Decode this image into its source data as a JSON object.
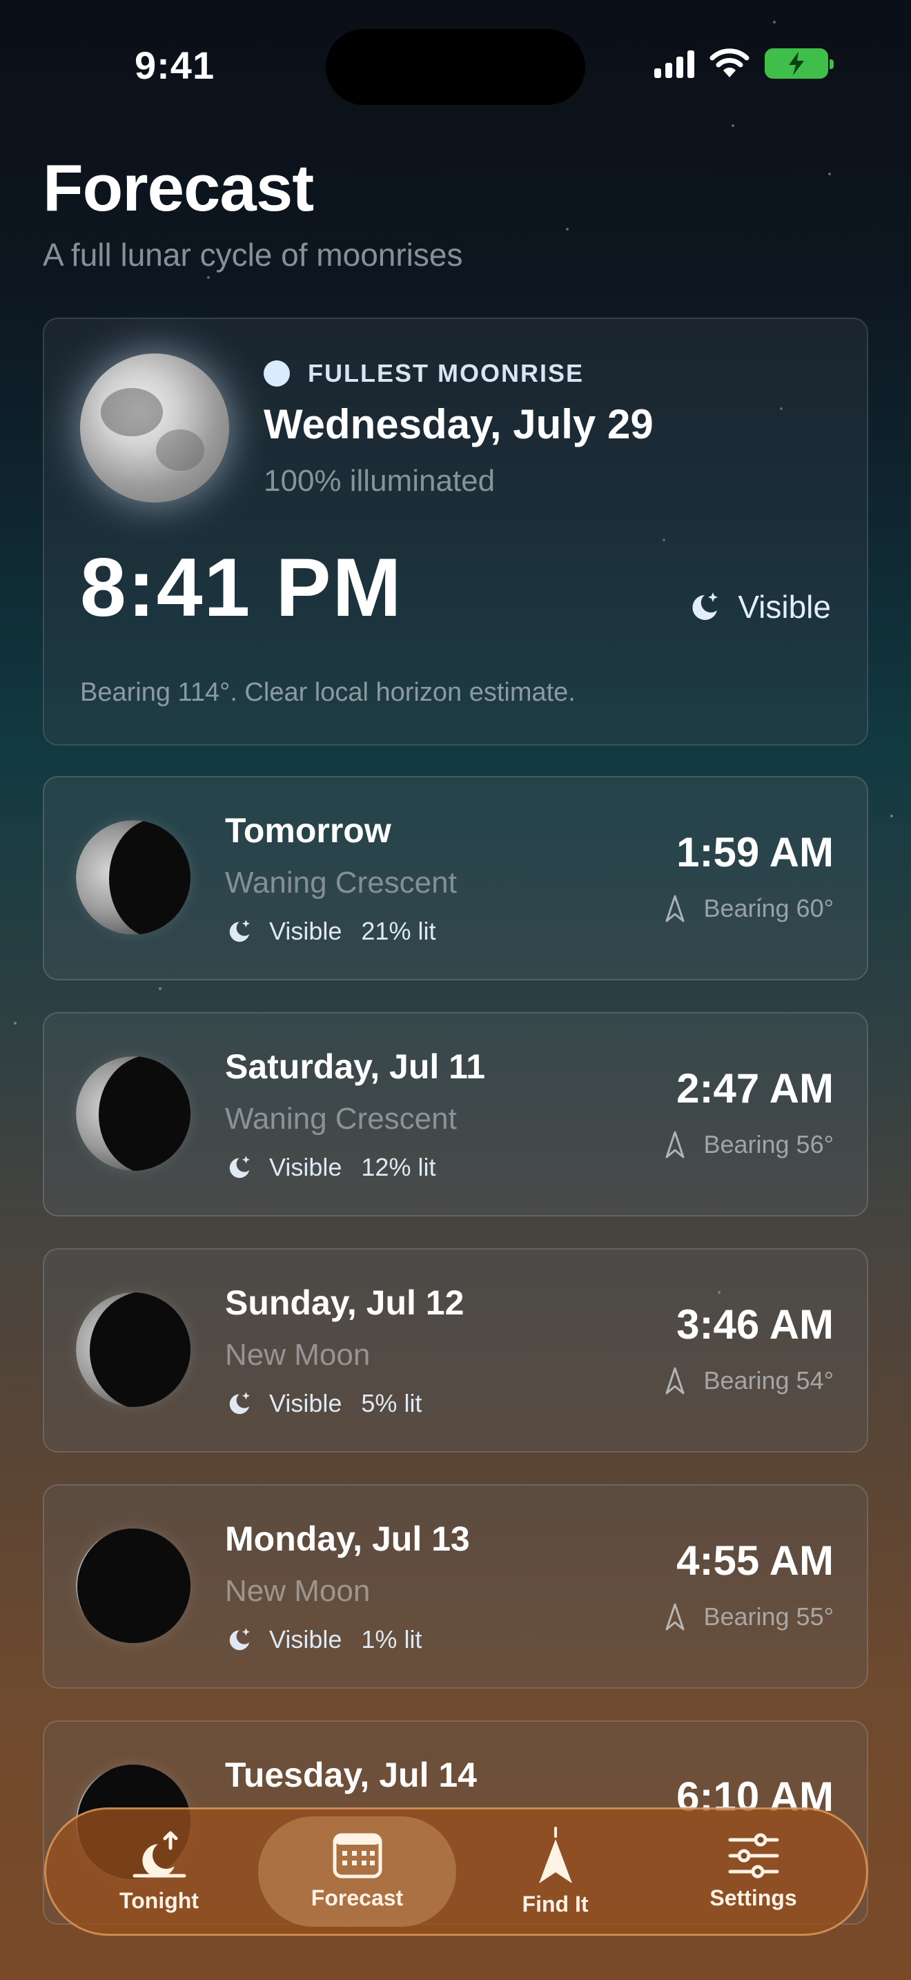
{
  "status": {
    "time": "9:41"
  },
  "header": {
    "title": "Forecast",
    "subtitle": "A full lunar cycle of moonrises"
  },
  "hero": {
    "label": "FULLEST MOONRISE",
    "date": "Wednesday, July 29",
    "illumination": "100% illuminated",
    "time": "8:41 PM",
    "visibility": "Visible",
    "bearing_note": "Bearing 114°. Clear local horizon estimate."
  },
  "days": [
    {
      "title": "Tomorrow",
      "phase": "Waning Crescent",
      "visibility": "Visible",
      "lit": "21% lit",
      "time": "1:59 AM",
      "bearing": "Bearing 60°",
      "illumination_fraction": 0.21
    },
    {
      "title": "Saturday, Jul 11",
      "phase": "Waning Crescent",
      "visibility": "Visible",
      "lit": "12% lit",
      "time": "2:47 AM",
      "bearing": "Bearing 56°",
      "illumination_fraction": 0.12
    },
    {
      "title": "Sunday, Jul 12",
      "phase": "New Moon",
      "visibility": "Visible",
      "lit": "5% lit",
      "time": "3:46 AM",
      "bearing": "Bearing 54°",
      "illumination_fraction": 0.05
    },
    {
      "title": "Monday, Jul 13",
      "phase": "New Moon",
      "visibility": "Visible",
      "lit": "1% lit",
      "time": "4:55 AM",
      "bearing": "Bearing 55°",
      "illumination_fraction": 0.01
    },
    {
      "title": "Tuesday, Jul 14",
      "phase": "",
      "visibility": "",
      "lit": "",
      "time": "6:10 AM",
      "bearing": "",
      "illumination_fraction": 0.0
    }
  ],
  "tabs": [
    {
      "label": "Tonight",
      "icon": "moonrise-icon",
      "active": false
    },
    {
      "label": "Forecast",
      "icon": "calendar-icon",
      "active": true
    },
    {
      "label": "Find It",
      "icon": "compass-arrow-icon",
      "active": false
    },
    {
      "label": "Settings",
      "icon": "sliders-icon",
      "active": false
    }
  ],
  "colors": {
    "accent": "#d9ecff",
    "battery": "#3fbf4a",
    "tab_bar": "#96501e"
  }
}
